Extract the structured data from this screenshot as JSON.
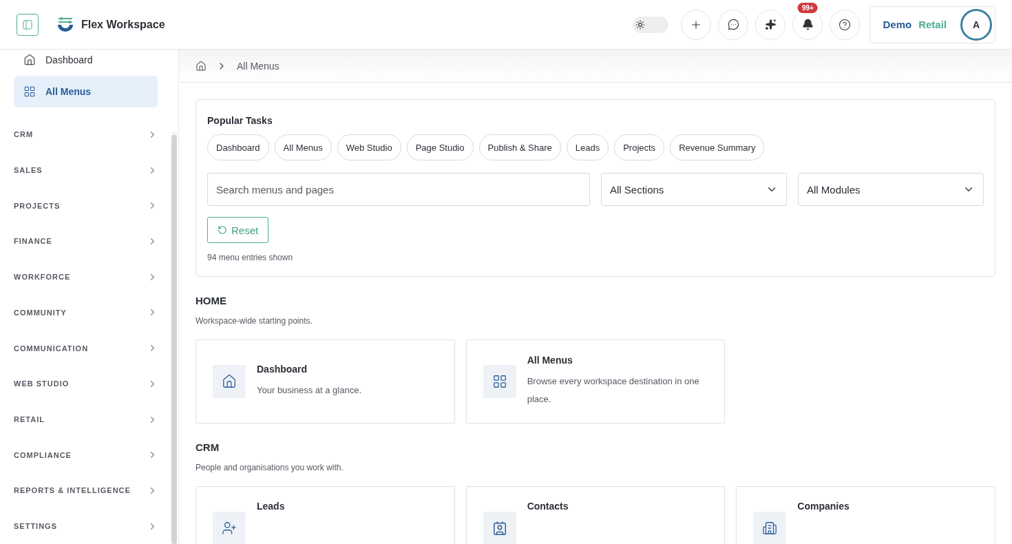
{
  "header": {
    "app_name": "Flex Workspace",
    "theme_toggle": {
      "on": false
    },
    "notifications_badge": "99+",
    "workspace": {
      "name_1": "Demo",
      "name_2": "Retail"
    },
    "avatar_initial": "A"
  },
  "sidebar": {
    "items": [
      {
        "label": "Dashboard",
        "kind": "home",
        "selected": false
      },
      {
        "label": "All Menus",
        "kind": "menus",
        "selected": true
      }
    ],
    "sections": [
      {
        "label": "CRM",
        "expanded": false
      },
      {
        "label": "SALES",
        "expanded": false
      },
      {
        "label": "PROJECTS",
        "expanded": false
      },
      {
        "label": "FINANCE",
        "expanded": false
      },
      {
        "label": "WORKFORCE",
        "expanded": false
      },
      {
        "label": "COMMUNITY",
        "expanded": false
      },
      {
        "label": "COMMUNICATION",
        "expanded": false
      },
      {
        "label": "WEB STUDIO",
        "expanded": false
      },
      {
        "label": "RETAIL",
        "expanded": false
      },
      {
        "label": "COMPLIANCE",
        "expanded": false
      },
      {
        "label": "REPORTS & INTELLIGENCE",
        "expanded": false
      },
      {
        "label": "SETTINGS",
        "expanded": false
      }
    ]
  },
  "breadcrumb": [
    "All Menus"
  ],
  "popular_tasks": {
    "title": "Popular Tasks",
    "chips": [
      "Dashboard",
      "All Menus",
      "Web Studio",
      "Page Studio",
      "Publish & Share",
      "Leads",
      "Projects",
      "Revenue Summary"
    ],
    "search": {
      "placeholder": "Search menus and pages"
    },
    "section_filter": "All Sections",
    "module_filter": "All Modules",
    "reset_label": "Reset",
    "count": "94 menu entries shown"
  },
  "groups": [
    {
      "title": "HOME",
      "description": "Workspace-wide starting points.",
      "cards": [
        {
          "kind": "home",
          "title": "Dashboard",
          "description": "Your business at a glance."
        },
        {
          "kind": "menus",
          "title": "All Menus",
          "description": "Browse every workspace destination in one place."
        }
      ]
    },
    {
      "title": "CRM",
      "description": "People and organisations you work with.",
      "cards": [
        {
          "kind": "leads",
          "title": "Leads"
        },
        {
          "kind": "contacts",
          "title": "Contacts"
        },
        {
          "kind": "companies",
          "title": "Companies"
        }
      ]
    }
  ]
}
